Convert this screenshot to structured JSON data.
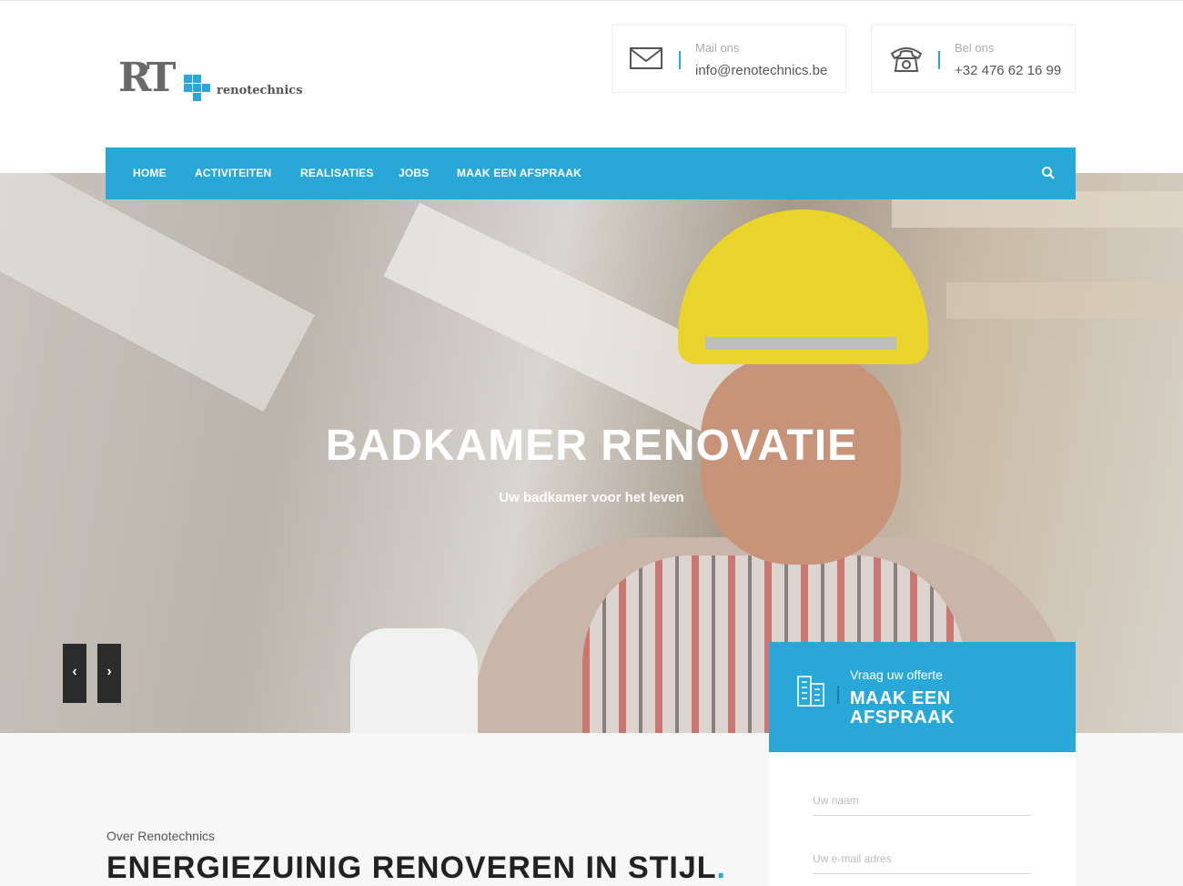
{
  "brand": {
    "logo_letters": "RT",
    "logo_name": "renotechnics",
    "accent_color": "#29a8d8"
  },
  "contact": {
    "mail": {
      "label": "Mail ons",
      "value": "info@renotechnics.be",
      "icon": "envelope-icon"
    },
    "phone": {
      "label": "Bel ons",
      "value": "+32 476 62 16 99",
      "icon": "phone-icon"
    }
  },
  "nav": {
    "items": [
      {
        "label": "HOME"
      },
      {
        "label": "ACTIVITEITEN"
      },
      {
        "label": "REALISATIES"
      },
      {
        "label": "JOBS"
      },
      {
        "label": "MAAK EEN AFSPRAAK"
      }
    ],
    "search_icon": "search-icon"
  },
  "hero": {
    "title": "BADKAMER RENOVATIE",
    "subtitle": "Uw badkamer voor het leven",
    "prev_icon": "chevron-left-icon",
    "next_icon": "chevron-right-icon"
  },
  "offerte": {
    "label": "Vraag uw offerte",
    "title": "MAAK EEN AFSPRAAK",
    "icon": "building-icon",
    "form": {
      "name_placeholder": "Uw naam",
      "email_placeholder": "Uw e-mail adres"
    }
  },
  "about": {
    "label": "Over Renotechnics",
    "title": "ENERGIEZUINIG RENOVEREN IN STIJL",
    "title_dot": "."
  }
}
